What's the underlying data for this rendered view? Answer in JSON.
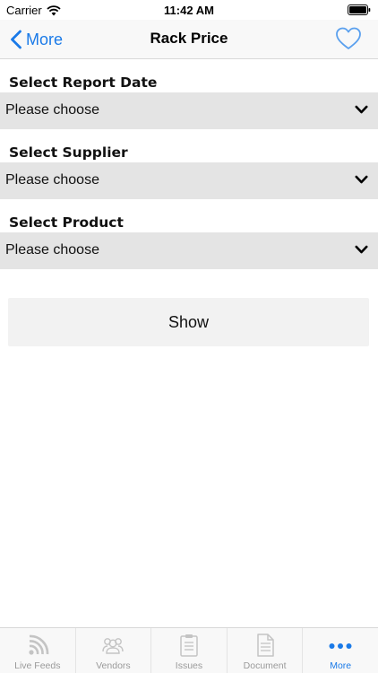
{
  "status_bar": {
    "carrier": "Carrier",
    "time": "11:42 AM"
  },
  "nav": {
    "back_label": "More",
    "title": "Rack Price"
  },
  "form": {
    "report_date": {
      "label": "Select Report Date",
      "value": "Please choose"
    },
    "supplier": {
      "label": "Select Supplier",
      "value": "Please choose"
    },
    "product": {
      "label": "Select Product",
      "value": "Please choose"
    },
    "show_label": "Show"
  },
  "tabs": [
    {
      "label": "Live Feeds",
      "icon": "rss-feed-icon",
      "active": false
    },
    {
      "label": "Vendors",
      "icon": "group-icon",
      "active": false
    },
    {
      "label": "Issues",
      "icon": "clipboard-icon",
      "active": false
    },
    {
      "label": "Document",
      "icon": "document-icon",
      "active": false
    },
    {
      "label": "More",
      "icon": "more-dots-icon",
      "active": true
    }
  ],
  "colors": {
    "accent": "#1a7ae8",
    "select_bg": "#e4e4e4",
    "button_bg": "#f2f2f2",
    "inactive_tab": "#9a9a9a"
  }
}
